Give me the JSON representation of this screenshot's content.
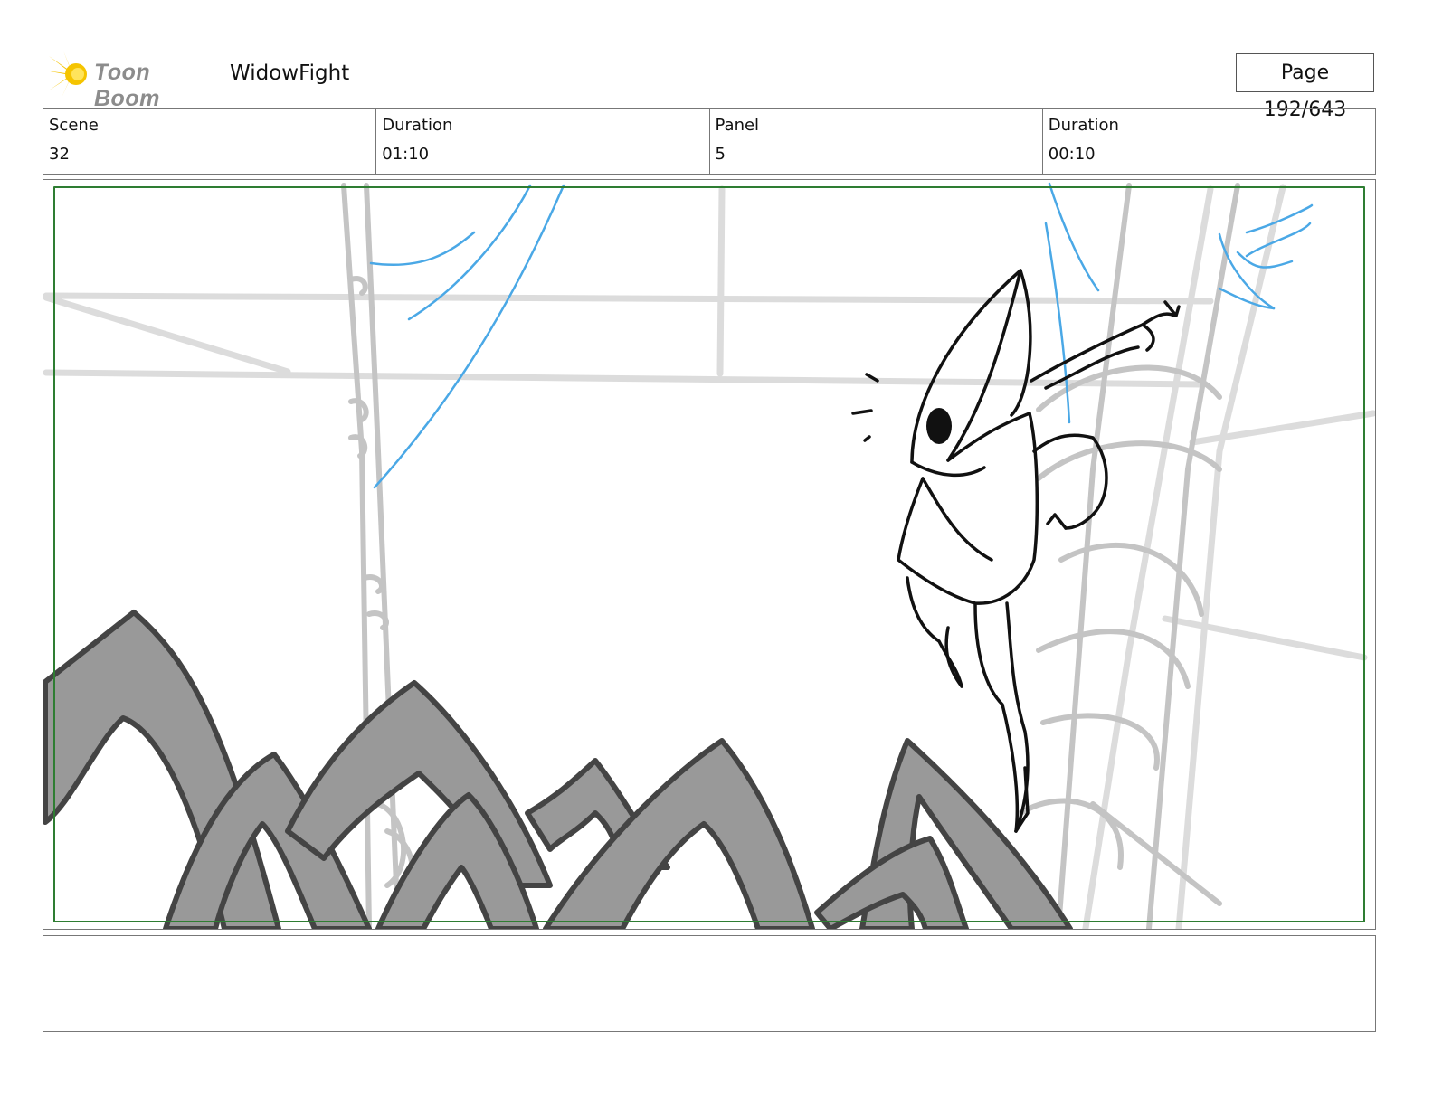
{
  "header": {
    "logo_text": "Toon Boom",
    "project_title": "WidowFight",
    "page_indicator": "Page 192/643"
  },
  "info": {
    "scene_label": "Scene",
    "scene_value": "32",
    "scene_duration_label": "Duration",
    "scene_duration_value": "01:10",
    "panel_label": "Panel",
    "panel_value": "5",
    "panel_duration_label": "Duration",
    "panel_duration_value": "00:10"
  },
  "panel": {
    "safe_frame_color": "#2e7d32",
    "sketch_colors": {
      "ink": "#111111",
      "fill": "#999999",
      "outline": "#444444",
      "blue": "#3ea0e0",
      "background_lines": "#d0d0d0"
    }
  },
  "notes": {
    "text": ""
  }
}
